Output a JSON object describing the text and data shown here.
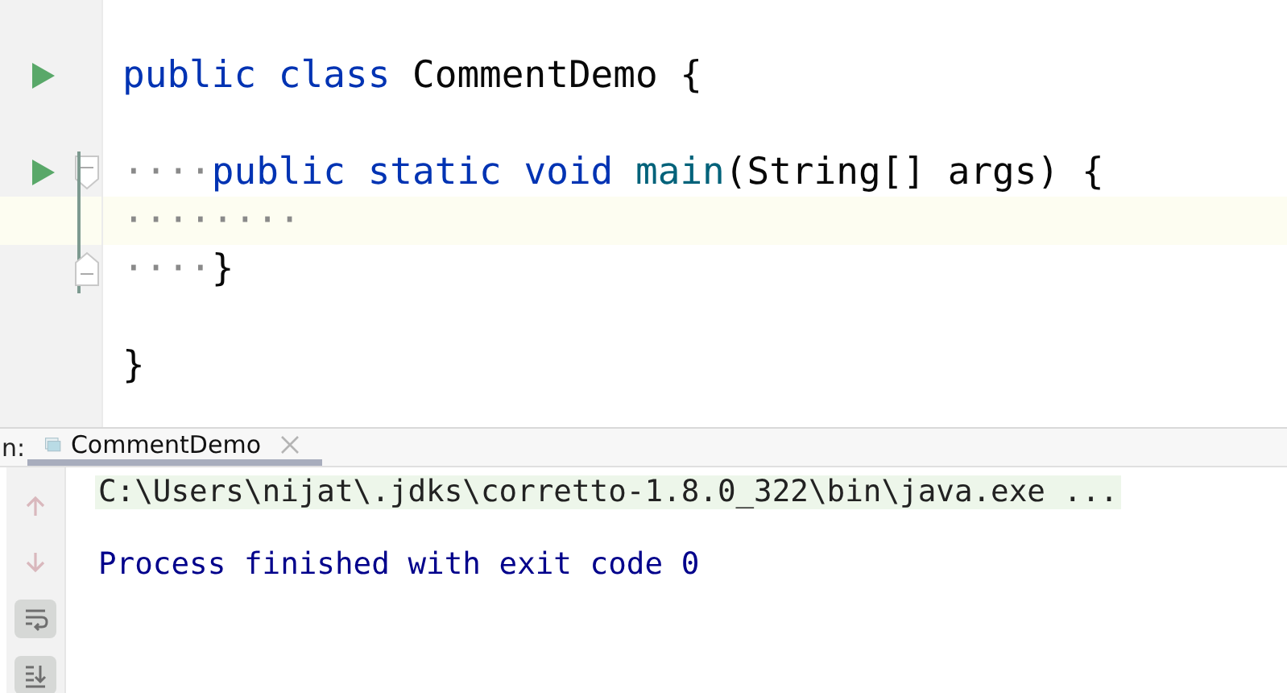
{
  "editor": {
    "lines": [
      {
        "tokens": [
          {
            "kind": "keyword",
            "text": "public class "
          },
          {
            "kind": "plain",
            "text": "CommentDemo {"
          }
        ],
        "run": true,
        "fold": false,
        "current": false
      },
      {
        "run": false,
        "fold": false,
        "current": false
      },
      {
        "indent": "····",
        "tokens": [
          {
            "kind": "keyword",
            "text": "public static void "
          },
          {
            "kind": "method",
            "text": "main"
          },
          {
            "kind": "plain",
            "text": "(String[] args) {"
          }
        ],
        "run": true,
        "fold": true,
        "current": false
      },
      {
        "indent": "········",
        "run": false,
        "fold": false,
        "current": true
      },
      {
        "indent": "····",
        "tokens": [
          {
            "kind": "plain",
            "text": "}"
          }
        ],
        "run": false,
        "fold": true,
        "current": false
      },
      {
        "run": false,
        "fold": false,
        "current": false
      },
      {
        "tokens": [
          {
            "kind": "plain",
            "text": "}"
          }
        ],
        "run": false,
        "fold": false,
        "current": false
      }
    ]
  },
  "run_panel": {
    "label": "n:",
    "tabs": [
      {
        "label": "CommentDemo",
        "selected": true
      }
    ],
    "toolbar": [
      {
        "kind": "up",
        "disabled": true,
        "selected": false
      },
      {
        "kind": "down",
        "disabled": true,
        "selected": false
      },
      {
        "kind": "wrap",
        "disabled": false,
        "selected": true
      },
      {
        "kind": "scroll",
        "disabled": false,
        "selected": true
      }
    ],
    "console": [
      {
        "kind": "command",
        "text": "C:\\Users\\nijat\\.jdks\\corretto-1.8.0_322\\bin\\java.exe ..."
      },
      {
        "kind": "blank"
      },
      {
        "kind": "output",
        "text": "Process finished with exit code 0"
      }
    ]
  }
}
